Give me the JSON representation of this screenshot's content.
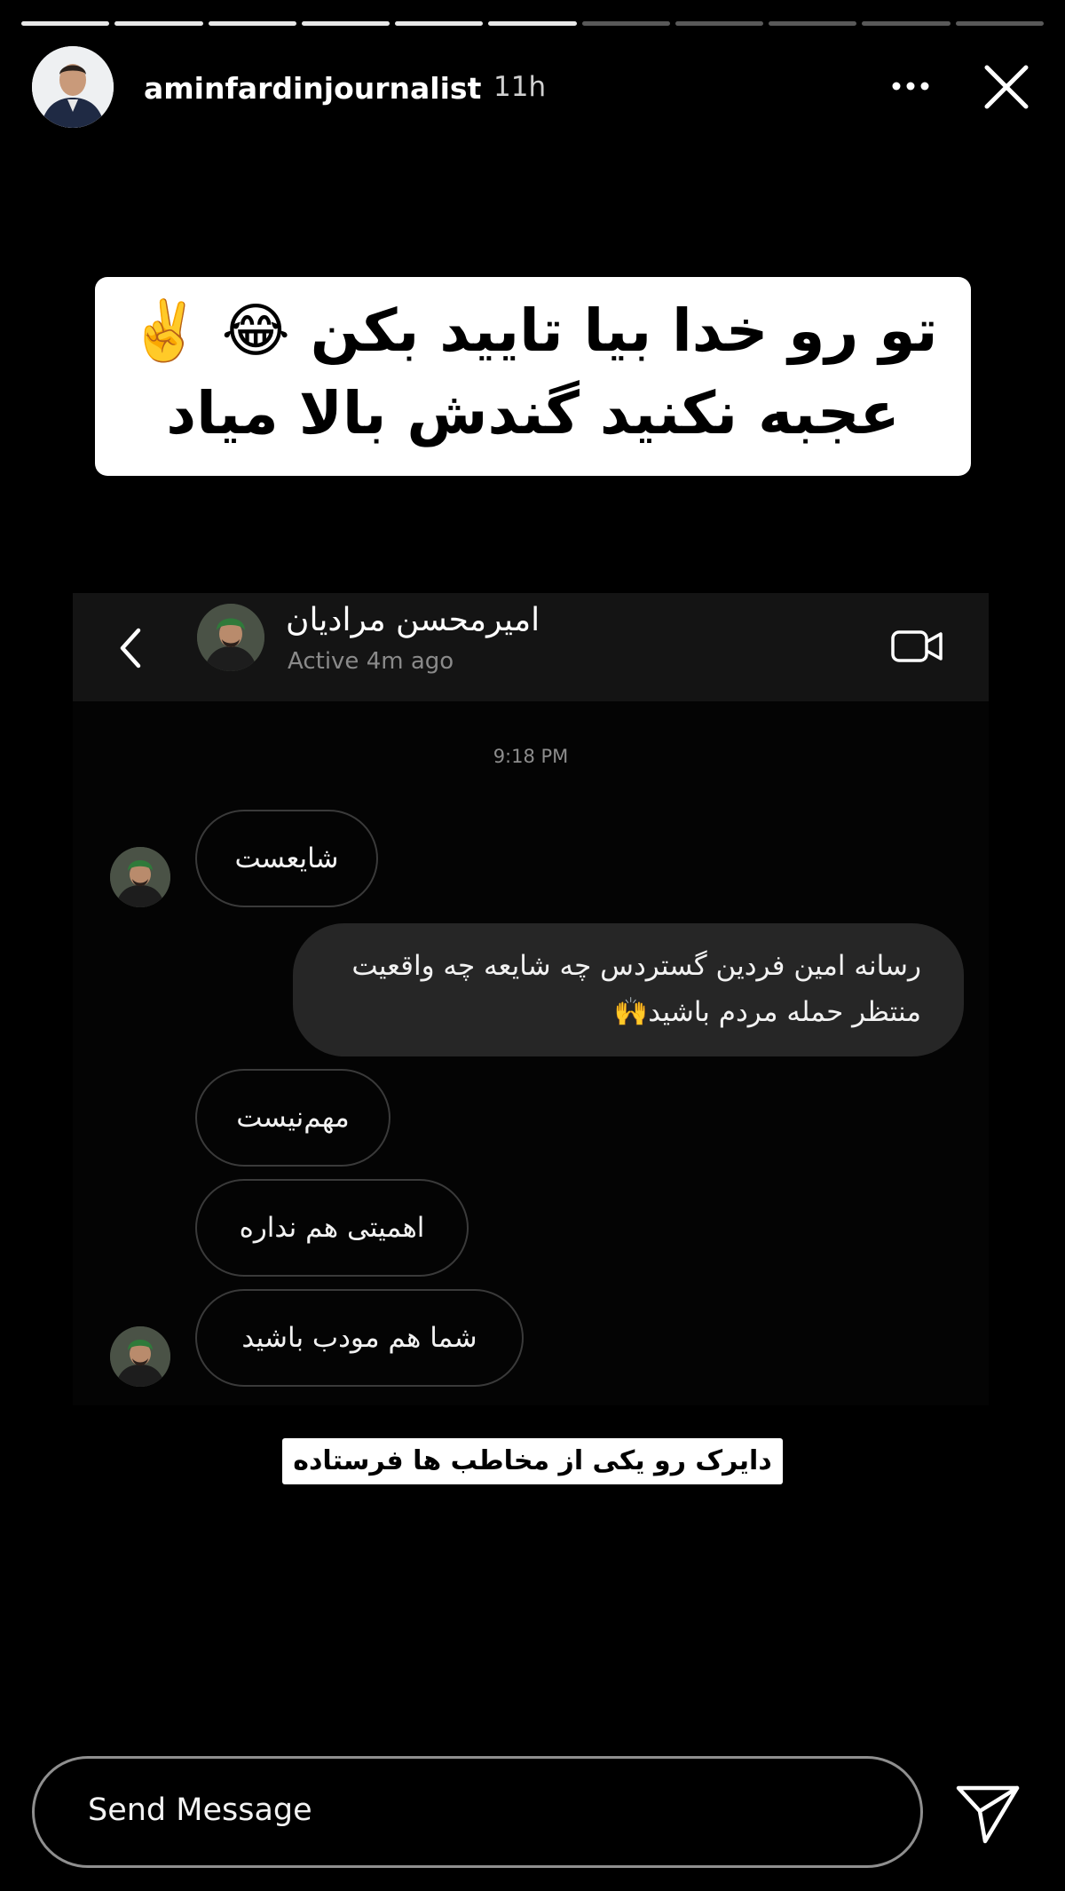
{
  "story": {
    "progress_segments": 11,
    "progress_completed": 6,
    "username": "aminfardinjournalist",
    "time_ago": "11h"
  },
  "headline": {
    "line1": "تو رو خدا بیا تایید بکن 😂 ✌️",
    "line2": "عجبه نکنید گندش بالا میاد"
  },
  "dm": {
    "contact_name": "امیرمحسن مرادیان",
    "status": "Active 4m ago",
    "timestamp": "9:18 PM",
    "messages": [
      {
        "text": "شایعست"
      },
      {
        "line1": "رسانه امین فردین گستردس چه شایعه چه واقعیت",
        "line2": "منتظر حمله مردم باشید🙌"
      },
      {
        "text": "مهم‌نیست"
      },
      {
        "text": "اهمیتی هم نداره"
      },
      {
        "text": "شما هم مودب باشید"
      }
    ]
  },
  "caption": "دایرک رو یکی از مخاطب ها فرستاده",
  "footer": {
    "send_placeholder": "Send Message"
  },
  "colors": {
    "background": "#000000",
    "bubble_outgoing": "#262626",
    "bubble_border": "#3a3a3a",
    "muted_text": "#8a8a8a"
  }
}
